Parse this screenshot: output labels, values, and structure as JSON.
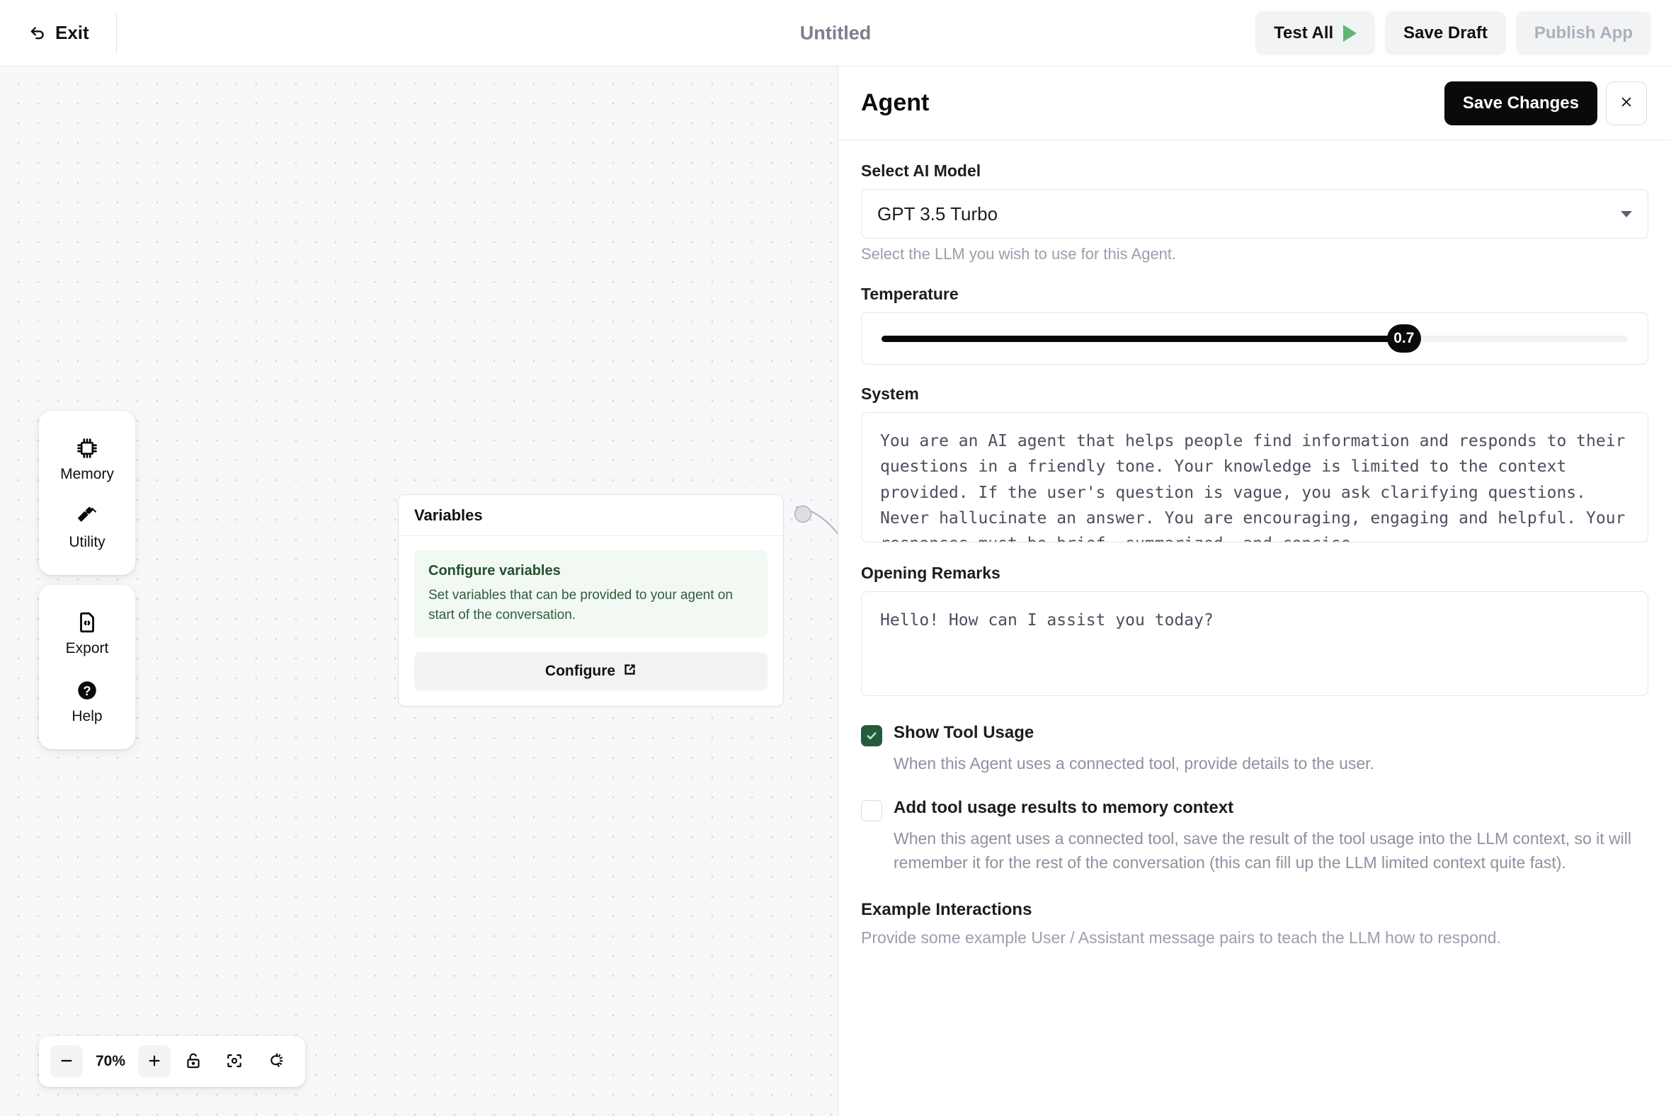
{
  "topbar": {
    "exit_label": "Exit",
    "exit_icon": "back-arrow-icon",
    "app_title": "Untitled",
    "test_all_label": "Test All",
    "play_icon": "play-icon",
    "save_draft_label": "Save Draft",
    "publish_label": "Publish App"
  },
  "canvas": {
    "tools": [
      {
        "label": "Memory",
        "icon": "chip-icon"
      },
      {
        "label": "Utility",
        "icon": "hammer-icon"
      },
      {
        "label": "Export",
        "icon": "file-code-icon"
      },
      {
        "label": "Help",
        "icon": "question-circle-icon"
      }
    ],
    "node": {
      "title": "Variables",
      "info_title": "Configure variables",
      "info_desc": "Set variables that can be provided to your agent on start of the conversation.",
      "button_label": "Configure",
      "button_icon": "external-link-icon"
    },
    "zoombar": {
      "zoom_out_icon": "minus-icon",
      "zoom_level": "70%",
      "zoom_in_icon": "plus-icon",
      "lock_icon": "unlock-icon",
      "fit_icon": "fit-view-icon",
      "clear_icon": "clear-canvas-icon"
    }
  },
  "panel": {
    "title": "Agent",
    "save_changes_label": "Save Changes",
    "close_icon": "close-icon",
    "model": {
      "label": "Select AI Model",
      "value": "GPT 3.5 Turbo",
      "hint": "Select the LLM you wish to use for this Agent.",
      "caret_icon": "chevron-down-icon"
    },
    "temperature": {
      "label": "Temperature",
      "value": "0.7",
      "value_number": 0.7,
      "min": 0,
      "max": 1,
      "percent": 70
    },
    "system": {
      "label": "System",
      "value": "You are an AI agent that helps people find information and responds to their questions in a friendly tone. Your knowledge is limited to the context provided. If the user's question is vague, you ask clarifying questions. Never hallucinate an answer. You are encouraging, engaging and helpful. Your responses must be brief, summarized, and concise.",
      "placeholder": ""
    },
    "opening_remarks": {
      "label": "Opening Remarks",
      "value": "Hello! How can I assist you today?",
      "placeholder": ""
    },
    "show_tool_usage": {
      "label": "Show Tool Usage",
      "desc": "When this Agent uses a connected tool, provide details to the user.",
      "checked": true
    },
    "add_tool_memory": {
      "label": "Add tool usage results to memory context",
      "desc": "When this agent uses a connected tool, save the result of the tool usage into the LLM context, so it will remember it for the rest of the conversation (this can fill up the LLM limited context quite fast).",
      "checked": false
    },
    "example_interactions": {
      "title": "Example Interactions",
      "desc": "Provide some example User / Assistant message pairs to teach the LLM how to respond."
    }
  },
  "colors": {
    "accent_green": "#5fb775",
    "checkbox_green": "#275a38",
    "node_info_bg": "#f2f8f2",
    "node_info_text": "#2f5e3c",
    "dark": "#0a0a0c",
    "canvas_bg": "#f7f8fa"
  }
}
